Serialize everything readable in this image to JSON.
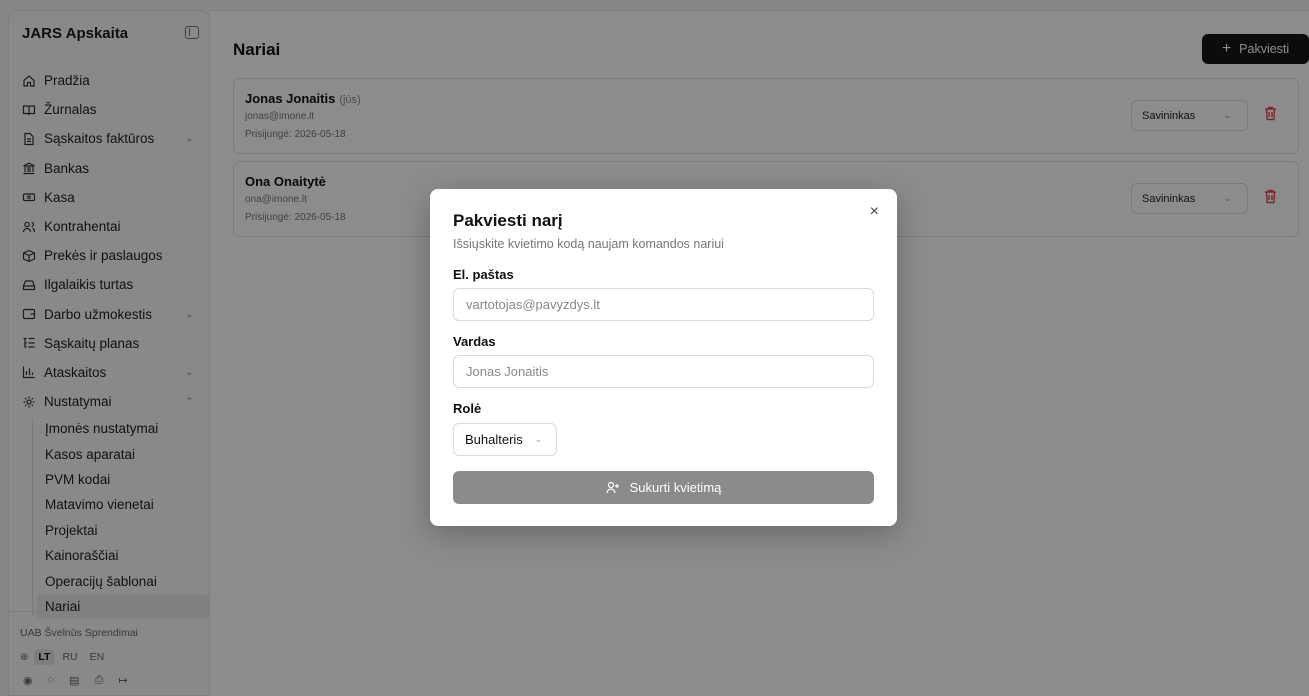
{
  "app": {
    "title": "JARS Apskaita"
  },
  "sidebar": {
    "items": [
      {
        "label": "Pradžia",
        "icon": "home-icon"
      },
      {
        "label": "Žurnalas",
        "icon": "book-icon"
      },
      {
        "label": "Sąskaitos faktūros",
        "icon": "file-icon",
        "expanded": false
      },
      {
        "label": "Bankas",
        "icon": "bank-icon"
      },
      {
        "label": "Kasa",
        "icon": "cash-icon"
      },
      {
        "label": "Kontrahentai",
        "icon": "users-icon"
      },
      {
        "label": "Prekės ir paslaugos",
        "icon": "package-icon"
      },
      {
        "label": "Ilgalaikis turtas",
        "icon": "drive-icon"
      },
      {
        "label": "Darbo užmokestis",
        "icon": "wallet-icon",
        "expanded": false
      },
      {
        "label": "Sąskaitų planas",
        "icon": "list-tree-icon"
      },
      {
        "label": "Ataskaitos",
        "icon": "bar-chart-icon",
        "expanded": false
      },
      {
        "label": "Nustatymai",
        "icon": "gear-icon",
        "expanded": true
      }
    ],
    "subitems": [
      "Įmonės nustatymai",
      "Kasos aparatai",
      "PVM kodai",
      "Matavimo vienetai",
      "Projektai",
      "Kainoraščiai",
      "Operacijų šablonai",
      "Nariai"
    ],
    "active_subitem": "Nariai",
    "company": "UAB Švelnūs Sprendimai",
    "languages": [
      "LT",
      "RU",
      "EN"
    ],
    "active_language": "LT"
  },
  "main": {
    "title": "Nariai",
    "invite_button": "Pakviesti",
    "members": [
      {
        "name": "Jonas Jonaitis",
        "you": "(jūs)",
        "email": "jonas@imone.lt",
        "joined": "Prisijungė: 2026-05-18",
        "role": "Savininkas"
      },
      {
        "name": "Ona Onaitytė",
        "you": "",
        "email": "ona@imone.lt",
        "joined": "Prisijungė: 2026-05-18",
        "role": "Savininkas"
      }
    ]
  },
  "modal": {
    "title": "Pakviesti narį",
    "description": "Išsiųskite kvietimo kodą naujam komandos nariui",
    "email_label": "El. paštas",
    "email_placeholder": "vartotojas@pavyzdys.lt",
    "name_label": "Vardas",
    "name_placeholder": "Jonas Jonaitis",
    "role_label": "Rolė",
    "role_value": "Buhalteris",
    "submit_label": "Sukurti kvietimą",
    "close": "×"
  },
  "colors": {
    "danger": "#e5484d",
    "primary": "#161616",
    "submit_disabled": "#8b8b8b"
  }
}
